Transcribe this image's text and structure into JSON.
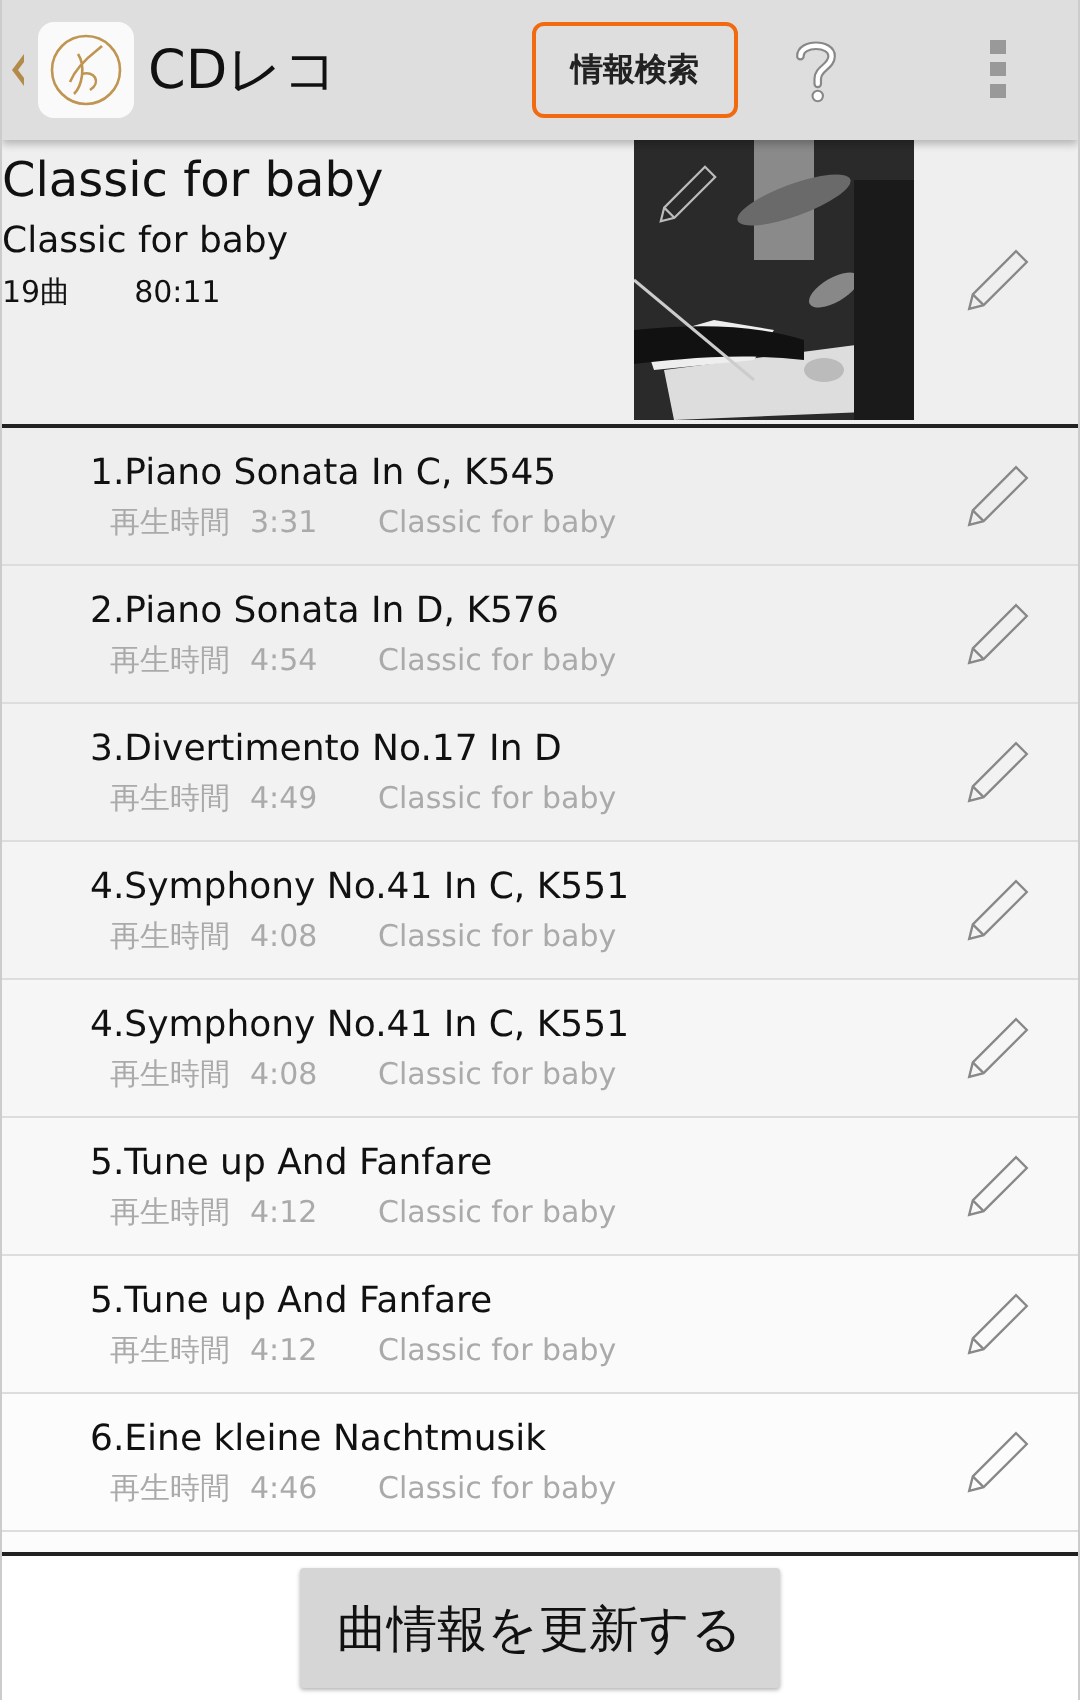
{
  "app_bar": {
    "title": "CDレコ",
    "search_button": "情報検索"
  },
  "album": {
    "title": "Classic for baby",
    "artist": "Classic for baby",
    "track_count": "19曲",
    "total_time": "80:11"
  },
  "tracks": [
    {
      "title": "1.Piano Sonata In C, K545",
      "time_label": "再生時間",
      "time": "3:31",
      "album": "Classic for baby"
    },
    {
      "title": "2.Piano Sonata In D, K576",
      "time_label": "再生時間",
      "time": "4:54",
      "album": "Classic for baby"
    },
    {
      "title": "3.Divertimento No.17 In D",
      "time_label": "再生時間",
      "time": "4:49",
      "album": "Classic for baby"
    },
    {
      "title": "4.Symphony No.41 In C, K551",
      "time_label": "再生時間",
      "time": "4:08",
      "album": "Classic for baby"
    },
    {
      "title": "4.Symphony No.41 In C, K551",
      "time_label": "再生時間",
      "time": "4:08",
      "album": "Classic for baby"
    },
    {
      "title": "5.Tune up And Fanfare",
      "time_label": "再生時間",
      "time": "4:12",
      "album": "Classic for baby"
    },
    {
      "title": "5.Tune up And Fanfare",
      "time_label": "再生時間",
      "time": "4:12",
      "album": "Classic for baby"
    },
    {
      "title": "6.Eine kleine Nachtmusik",
      "time_label": "再生時間",
      "time": "4:46",
      "album": "Classic for baby"
    }
  ],
  "update_button": "曲情報を更新する"
}
